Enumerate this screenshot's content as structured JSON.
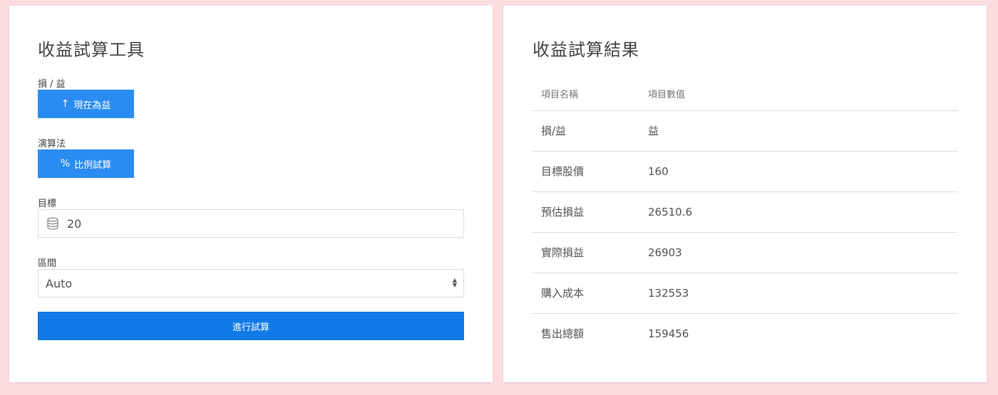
{
  "calculator": {
    "title": "收益試算工具",
    "profit_loss": {
      "label": "損 / 益",
      "button_icon": "↑",
      "button_label": "現在為益"
    },
    "algorithm": {
      "label": "演算法",
      "button_icon": "%",
      "button_label": "比例試算"
    },
    "target": {
      "label": "目標",
      "icon": "database-icon",
      "value": "20"
    },
    "range": {
      "label": "區間",
      "selected": "Auto"
    },
    "submit_label": "進行試算"
  },
  "results": {
    "title": "收益試算結果",
    "headers": [
      "項目名稱",
      "項目數值"
    ],
    "rows": [
      {
        "name": "損/益",
        "value": "益"
      },
      {
        "name": "目標股價",
        "value": "160"
      },
      {
        "name": "預估損益",
        "value": "26510.6"
      },
      {
        "name": "實際損益",
        "value": "26903"
      },
      {
        "name": "購入成本",
        "value": "132553"
      },
      {
        "name": "售出總額",
        "value": "159456"
      }
    ]
  },
  "colors": {
    "background": "#fbdde0",
    "toggle_button": "#2a8cf0",
    "submit_button": "#107ae6"
  }
}
